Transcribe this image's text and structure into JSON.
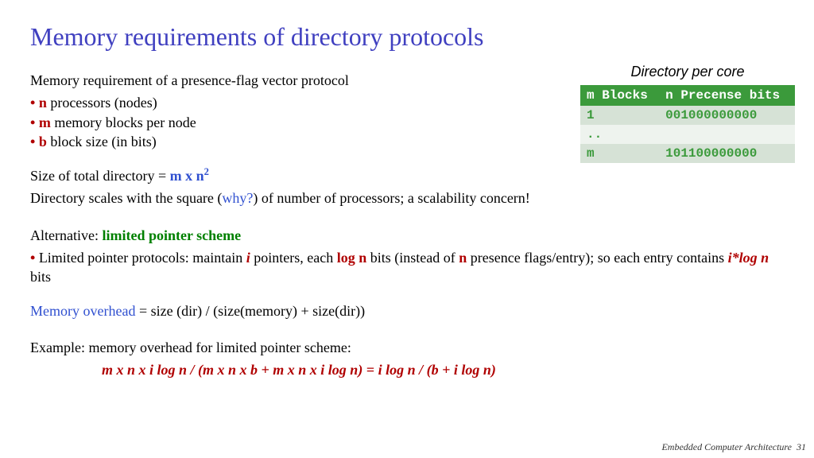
{
  "title": "Memory requirements of directory protocols",
  "intro": "Memory requirement of a presence-flag vector protocol",
  "bullets": {
    "b1_var": "n",
    "b1_rest": " processors (nodes)",
    "b2_var": "m",
    "b2_rest": " memory blocks per node",
    "b3_var": "b",
    "b3_rest": " block size (in bits)"
  },
  "sizeline": {
    "lead": "Size of total directory = ",
    "expr_pre": "m x n",
    "expr_sup": "2"
  },
  "scaleline": {
    "pre": "Directory scales with the square (",
    "why": "why?",
    "post": ") of number of processors; a scalability concern!"
  },
  "alt": {
    "lead": "Alternative: ",
    "scheme": "limited pointer scheme"
  },
  "altbullet": {
    "pre": "Limited pointer protocols: maintain ",
    "i": "i",
    "mid1": " pointers, each ",
    "logn": "log n",
    "mid2": " bits (instead of ",
    "n": "n",
    "mid3": " presence flags/entry); so each entry contains ",
    "ilogn": "i*log n",
    "post": " bits"
  },
  "overhead": {
    "label": "Memory overhead",
    "rest": " = size (dir) / (size(memory) + size(dir))"
  },
  "example_lead": "Example: memory overhead for limited pointer scheme:",
  "example_eq": "m x n x i log n / (m x n x b + m x n x  i log n)  = i log n / (b + i  log n)",
  "side_caption": "Directory per core",
  "table": {
    "h1": "m Blocks",
    "h2": "n Precense bits",
    "r0c0": "1",
    "r0c1": "001000000000",
    "r1c0": "..",
    "r1c1": "",
    "r2c0": "m",
    "r2c1": "101100000000"
  },
  "footer_course": "Embedded Computer Architecture",
  "footer_page": "31"
}
